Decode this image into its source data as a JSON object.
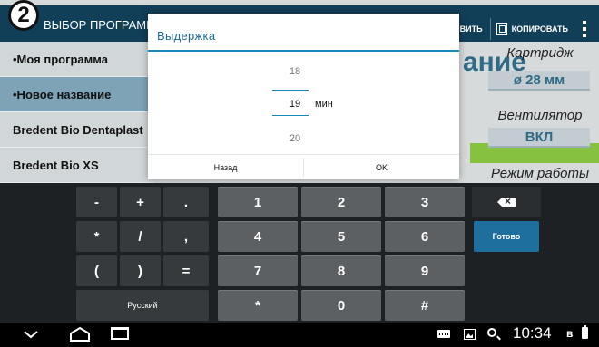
{
  "app": {
    "step_number": "2",
    "title": "ВЫБОР ПРОГРАММ",
    "save_label": "ВИТЬ",
    "copy_label": "КОПИРОВАТЬ",
    "programs": [
      {
        "label": "•Моя программа"
      },
      {
        "label": "•Новое название"
      },
      {
        "label": "Bredent Bio Dentaplast"
      },
      {
        "label": "Bredent Bio XS"
      }
    ],
    "selected_program_index": 1,
    "big_title": "ание",
    "cartridge_label": "Картридж",
    "cartridge_value": "ø 28 мм",
    "fan_label": "Вентилятор",
    "fan_value": "ВКЛ",
    "mode_label": "Режим работы"
  },
  "dialog": {
    "title": "Выдержка",
    "picker_prev": "18",
    "picker_current": "19",
    "picker_next": "20",
    "unit": "мин",
    "back_label": "Назад",
    "ok_label": "OK"
  },
  "keyboard": {
    "row1": [
      "-",
      "+",
      ".",
      "1",
      "2",
      "3"
    ],
    "row2": [
      "*",
      "/",
      ",",
      "4",
      "5",
      "6"
    ],
    "row3": [
      "(",
      ")",
      "=",
      "7",
      "8",
      "9"
    ],
    "row4": [
      "*",
      "0",
      "#"
    ],
    "language_label": "Русский",
    "done_label": "Готово"
  },
  "statusbar": {
    "time": "10:34",
    "bluetooth_glyph": "ʙ"
  }
}
